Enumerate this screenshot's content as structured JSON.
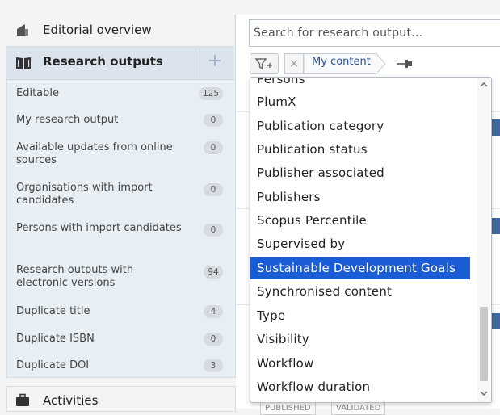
{
  "sidebar": {
    "editorial_overview": "Editorial overview",
    "research_outputs": "Research outputs",
    "items": [
      {
        "label": "Editable",
        "count": "125"
      },
      {
        "label": "My research output",
        "count": "0"
      },
      {
        "label": "Available updates from online sources",
        "count": "0"
      },
      {
        "label": "Organisations with import candidates",
        "count": "0"
      },
      {
        "label": "Persons with import candidates",
        "count": "0"
      },
      {
        "label": "Research outputs with electronic versions",
        "count": "94"
      },
      {
        "label": "Duplicate title",
        "count": "4"
      },
      {
        "label": "Duplicate ISBN",
        "count": "0"
      },
      {
        "label": "Duplicate DOI",
        "count": "3"
      }
    ],
    "activities": "Activities"
  },
  "search": {
    "placeholder": "Search for research output..."
  },
  "filter_tag": {
    "label": "My content"
  },
  "dropdown": {
    "options": [
      "Persons",
      "PlumX",
      "Publication category",
      "Publication status",
      "Publisher associated",
      "Publishers",
      "Scopus Percentile",
      "Supervised by",
      "Sustainable Development Goals",
      "Synchronised content",
      "Type",
      "Visibility",
      "Workflow",
      "Workflow duration"
    ],
    "selected": "Sustainable Development Goals"
  },
  "results_peek": {
    "tags": [
      "PUBLISHED",
      "VALIDATED"
    ]
  },
  "colors": {
    "accent": "#1a5bd6",
    "sidebar_bg": "#e7eef4",
    "link_blue": "#2a4d93"
  }
}
